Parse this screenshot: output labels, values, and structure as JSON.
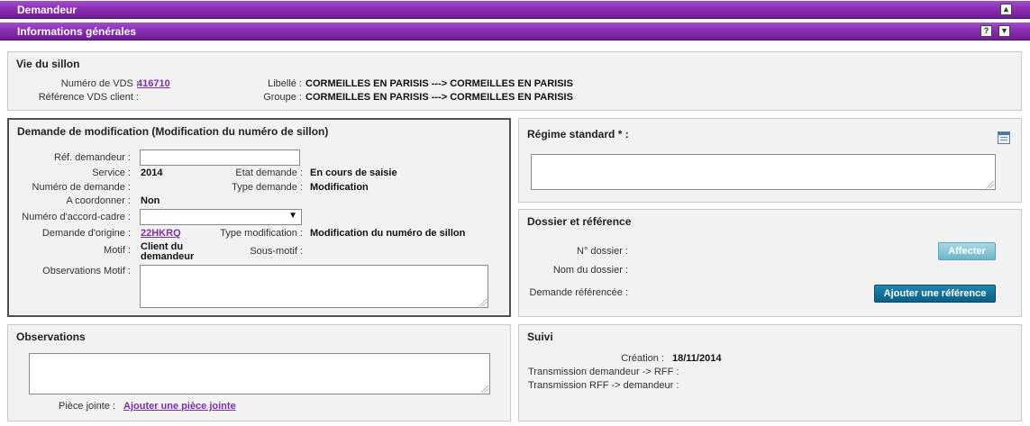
{
  "header": {
    "demandeur_title": "Demandeur",
    "collapse_glyph": "▲",
    "info_title": "Informations générales",
    "help_glyph": "?",
    "expand_glyph": "▼"
  },
  "vie_sillon": {
    "title": "Vie du sillon",
    "numero_vds_label": "Numéro de VDS :",
    "numero_vds_value": "416710",
    "ref_vds_client_label": "Référence VDS client :",
    "libelle_label": "Libellé :",
    "libelle_value": "CORMEILLES EN PARISIS ---> CORMEILLES EN PARISIS",
    "groupe_label": "Groupe :",
    "groupe_value": "CORMEILLES EN PARISIS ---> CORMEILLES EN PARISIS"
  },
  "demande_modif": {
    "title": "Demande de modification (Modification du numéro de sillon)",
    "ref_demandeur_label": "Réf. demandeur :",
    "ref_demandeur_value": "",
    "service_label": "Service :",
    "service_value": "2014",
    "etat_label": "Etat demande :",
    "etat_value": "En cours de saisie",
    "numero_demande_label": "Numéro de demande :",
    "type_demande_label": "Type demande :",
    "type_demande_value": "Modification",
    "a_coordonner_label": "A coordonner :",
    "a_coordonner_value": "Non",
    "accord_cadre_label": "Numéro d'accord-cadre :",
    "accord_cadre_value": "",
    "demande_origine_label": "Demande d'origine :",
    "demande_origine_value": "22HKRQ",
    "type_modif_label": "Type modification :",
    "type_modif_value": "Modification du numéro de sillon",
    "motif_label": "Motif :",
    "motif_value_1": "Client du",
    "motif_value_2": "demandeur",
    "sous_motif_label": "Sous-motif :",
    "obs_motif_label": "Observations Motif :"
  },
  "regime": {
    "title": "Régime standard * :",
    "icon": "calendar-icon"
  },
  "dossier": {
    "title": "Dossier et référence",
    "no_dossier_label": "N° dossier :",
    "affecter_label": "Affecter",
    "nom_dossier_label": "Nom du dossier :",
    "demande_ref_label": "Demande référencée :",
    "ajouter_ref_label": "Ajouter une référence"
  },
  "observations": {
    "title": "Observations",
    "piece_jointe_label": "Pièce jointe :",
    "ajouter_piece_label": "Ajouter une pièce jointe"
  },
  "suivi": {
    "title": "Suivi",
    "creation_label": "Création :",
    "creation_value": "18/11/2014",
    "trans_dem_rff_label": "Transmission demandeur -> RFF :",
    "trans_rff_dem_label": "Transmission RFF -> demandeur :"
  },
  "colors": {
    "header_purple": "#8a30b4",
    "link_purple": "#7b2fa6",
    "panel_bg": "#f2f2f2",
    "button_light": "#6bb6c9",
    "button_dark": "#0b5f86"
  }
}
